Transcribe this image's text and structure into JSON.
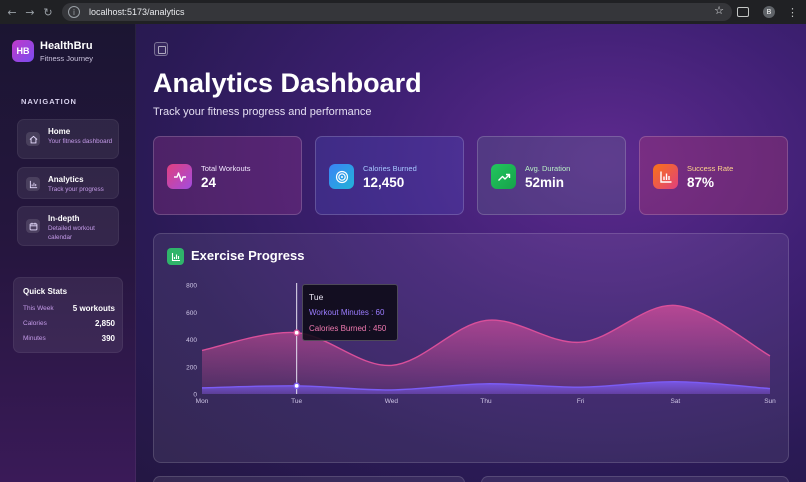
{
  "browser": {
    "url": "localhost:5173/analytics",
    "back_icon": "←",
    "forward_icon": "→",
    "reload_icon": "↻",
    "info_icon": "i",
    "star_icon": "☆",
    "profile_initial": "B",
    "menu_icon": "⋮"
  },
  "sidebar": {
    "logo_text": "HB",
    "app_name": "HealthBru",
    "tagline": "Fitness Journey",
    "nav_title": "NAVIGATION",
    "items": [
      {
        "label": "Home",
        "desc": "Your fitness dashboard",
        "icon": "home-icon"
      },
      {
        "label": "Analytics",
        "desc": "Track your progress",
        "icon": "bar-chart-icon"
      },
      {
        "label": "In-depth",
        "desc": "Detailed workout calendar",
        "icon": "calendar-icon"
      }
    ],
    "quick_stats": {
      "title": "Quick Stats",
      "rows": [
        {
          "label": "This Week",
          "value": "5 workouts"
        },
        {
          "label": "Calories",
          "value": "2,850"
        },
        {
          "label": "Minutes",
          "value": "390"
        }
      ]
    }
  },
  "main": {
    "title": "Analytics Dashboard",
    "subtitle": "Track your fitness progress and performance",
    "stats": [
      {
        "label": "Total Workouts",
        "value": "24",
        "icon": "activity-icon",
        "label_color": "#f3e9ff"
      },
      {
        "label": "Calories Burned",
        "value": "12,450",
        "icon": "target-icon",
        "label_color": "#a8c9ff"
      },
      {
        "label": "Avg. Duration",
        "value": "52min",
        "icon": "trending-up-icon",
        "label_color": "#b9f2c6"
      },
      {
        "label": "Success Rate",
        "value": "87%",
        "icon": "bar-chart-icon",
        "label_color": "#ffd58a"
      }
    ],
    "chart_title": "Exercise Progress",
    "tooltip": {
      "title": "Tue",
      "workout": "Workout Minutes : 60",
      "calories": "Calories Burned : 450"
    }
  },
  "colors": {
    "calories_series": "#d94f9a",
    "workout_series": "#7b5cf5",
    "accent_pink": "#f07ab0",
    "accent_purple": "#9b7cff"
  },
  "chart_data": {
    "type": "area",
    "categories": [
      "Mon",
      "Tue",
      "Wed",
      "Thu",
      "Fri",
      "Sat",
      "Sun"
    ],
    "series": [
      {
        "name": "Calories Burned",
        "values": [
          320,
          450,
          210,
          540,
          380,
          650,
          280
        ]
      },
      {
        "name": "Workout Minutes",
        "values": [
          45,
          60,
          30,
          75,
          50,
          90,
          40
        ]
      }
    ],
    "yticks": [
      0,
      200,
      400,
      600,
      800
    ],
    "ylim": [
      0,
      800
    ],
    "title": "Exercise Progress",
    "active_index": 1,
    "grid": false
  }
}
